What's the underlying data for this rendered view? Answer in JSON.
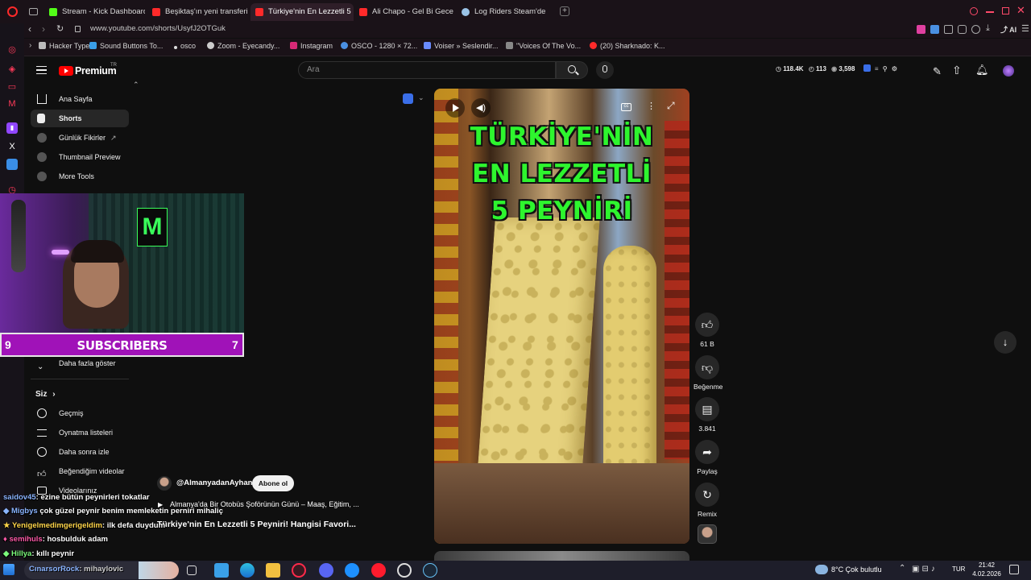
{
  "tabs": [
    {
      "label": "Stream - Kick Dashboard",
      "color": "#53fc18"
    },
    {
      "label": "Beşiktaş'ın yeni transferi C",
      "color": "#ff2a2a"
    },
    {
      "label": "Türkiye'nin En Lezzetli 5 P",
      "color": "#ff2a2a"
    },
    {
      "label": "Ali Chapo - Gel Bi Gece [C",
      "color": "#ff2a2a"
    },
    {
      "label": "Log Riders Steam'de",
      "color": "#9ac3e6"
    }
  ],
  "url": "www.youtube.com/shorts/UsyfJ2OTGuk",
  "bookmarks": [
    {
      "label": "Hacker Typer",
      "color": "#c0c0c0"
    },
    {
      "label": "Sound Buttons To...",
      "color": "#3a9ee8"
    },
    {
      "label": "osco",
      "color": "#dddddd"
    },
    {
      "label": "Zoom - Eyecandy...",
      "color": "#cccccc"
    },
    {
      "label": "Instagram",
      "color": "#d62976"
    },
    {
      "label": "OSCO - 1280 × 72...",
      "color": "#4a90e2"
    },
    {
      "label": "Voiser » Seslendir...",
      "color": "#6a8cff"
    },
    {
      "label": "\"Voices Of The Vo...",
      "color": "#888888"
    },
    {
      "label": "(20) Sharknado: K...",
      "color": "#ff2a2a"
    }
  ],
  "header": {
    "logo_text": "Premium",
    "region": "TR",
    "search_placeholder": "Ara",
    "ext_stats": [
      "118.4K",
      "113",
      "3,598"
    ],
    "ai_label": "AI"
  },
  "sidebar": {
    "top": [
      {
        "label": "Ana Sayfa",
        "icon": "home-icon"
      },
      {
        "label": "Shorts",
        "icon": "shorts-icon"
      },
      {
        "label": "Günlük Fikirler",
        "icon": "extension-icon"
      },
      {
        "label": "Thumbnail Preview",
        "icon": "extension-icon"
      },
      {
        "label": "More Tools",
        "icon": "extension-icon"
      }
    ],
    "more_label": "Daha fazla göster",
    "you_label": "Siz",
    "you_items": [
      {
        "label": "Geçmiş",
        "icon": "history-icon"
      },
      {
        "label": "Oynatma listeleri",
        "icon": "playlist-icon"
      },
      {
        "label": "Daha sonra izle",
        "icon": "clock-icon"
      },
      {
        "label": "Beğendiğim videolar",
        "icon": "like-icon"
      },
      {
        "label": "Videolarınız",
        "icon": "video-icon"
      }
    ]
  },
  "webcam": {
    "sub_left": "9",
    "sub_label": "SUBSCRIBERS",
    "sub_right": "7"
  },
  "video": {
    "overlay_title": [
      "TÜRKİYE'NİN",
      "EN LEZZETLİ",
      "5 PEYNİRİ"
    ],
    "channel": "@AlmanyadanAyhan",
    "subscribe_label": "Abone ol",
    "next_title": "Almanya'da Bir Otobüs Şoförünün Günü – Maaş, Eğitim, ...",
    "title": "Türkiye'nin En Lezzetli 5 Peyniri! Hangisi Favori..."
  },
  "actions": {
    "like_count": "61 B",
    "dislike_label": "Beğenme",
    "comment_count": "3.841",
    "share_label": "Paylaş",
    "remix_label": "Remix"
  },
  "chat": [
    {
      "user": "saidov45",
      "text": ": ezine bütün peynirleri tokatlar",
      "color": "#8ab4ff"
    },
    {
      "user": "Migbys",
      "text": " çok güzel peynir benim memleketin perniri mihaliç",
      "color": "#8ab4ff"
    },
    {
      "user": "Yenigelmedimgerigeldim",
      "text": ": ilk defa duydum",
      "color": "#ffd54a"
    },
    {
      "user": "semihuls",
      "text": ": hosbulduk adam",
      "color": "#ff5aa8"
    },
    {
      "user": "Hillya",
      "text": ": kıllı peynir",
      "color": "#7cfc7c"
    },
    {
      "user": "CınarsorRock",
      "text": ": mihaylovic",
      "color": "#8ab4ff"
    }
  ],
  "taskbar": {
    "weather": "8°C  Çok bulutlu",
    "lang": "TUR",
    "time": "21:42",
    "date": "4.02.2026"
  }
}
